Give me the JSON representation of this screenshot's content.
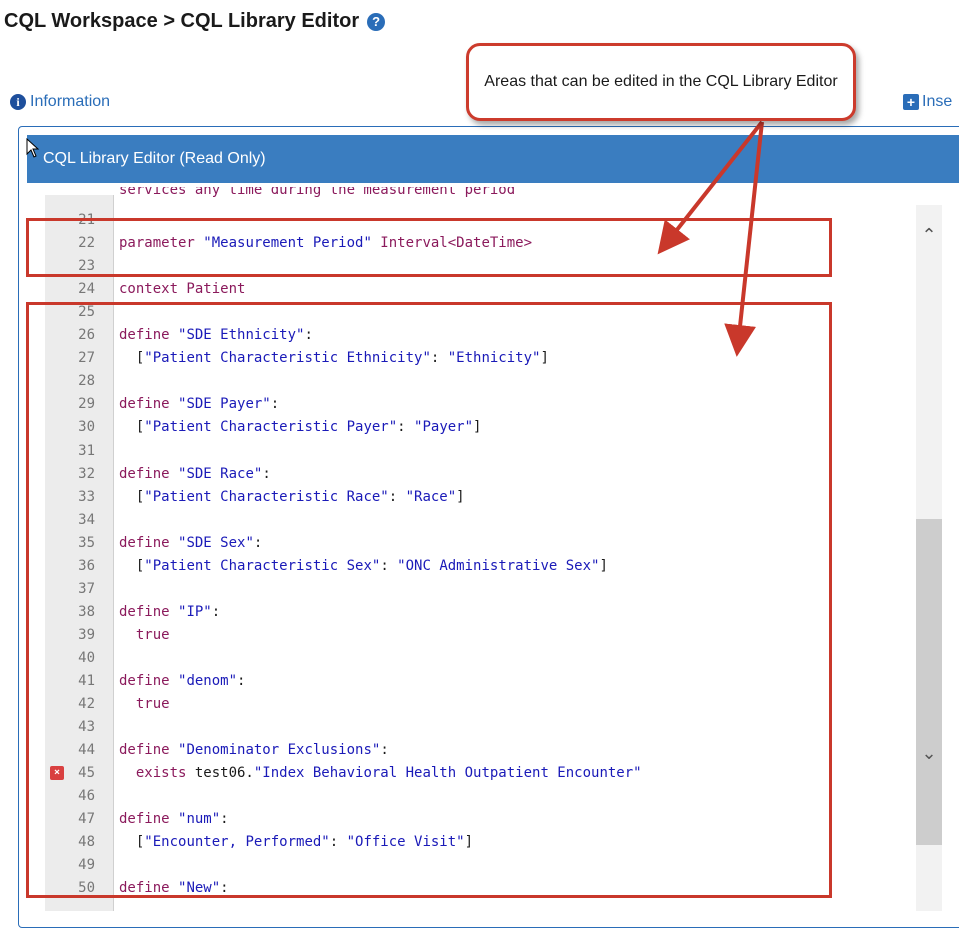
{
  "header": {
    "title": "CQL Workspace > CQL Library Editor",
    "help_icon": "question-circle-icon"
  },
  "toolbar": {
    "info_label": "Information",
    "insert_label": "Inse"
  },
  "panel": {
    "title": "CQL Library Editor (Read Only)"
  },
  "callout": {
    "text": "Areas that can be edited in the CQL Library Editor"
  },
  "colors": {
    "accent": "#3a7dc0",
    "highlight_red": "#c9382b",
    "keyword": "#8b1a5c",
    "string": "#1a1ab8"
  },
  "editor": {
    "partial_line_text": "services any time during the measurement period",
    "lines": [
      {
        "num": "21",
        "tokens": []
      },
      {
        "num": "22",
        "tokens": [
          {
            "t": "parameter ",
            "c": "kw"
          },
          {
            "t": "\"Measurement Period\"",
            "c": "str"
          },
          {
            "t": " Interval<DateTime>",
            "c": "kw"
          }
        ]
      },
      {
        "num": "23",
        "tokens": []
      },
      {
        "num": "24",
        "tokens": [
          {
            "t": "context Patient",
            "c": "kw"
          }
        ]
      },
      {
        "num": "25",
        "tokens": []
      },
      {
        "num": "26",
        "tokens": [
          {
            "t": "define ",
            "c": "kw"
          },
          {
            "t": "\"SDE Ethnicity\"",
            "c": "str"
          },
          {
            "t": ":",
            "c": "plain"
          }
        ]
      },
      {
        "num": "27",
        "tokens": [
          {
            "t": "  [",
            "c": "plain"
          },
          {
            "t": "\"Patient Characteristic Ethnicity\"",
            "c": "str"
          },
          {
            "t": ": ",
            "c": "plain"
          },
          {
            "t": "\"Ethnicity\"",
            "c": "str"
          },
          {
            "t": "]",
            "c": "plain"
          }
        ]
      },
      {
        "num": "28",
        "tokens": []
      },
      {
        "num": "29",
        "tokens": [
          {
            "t": "define ",
            "c": "kw"
          },
          {
            "t": "\"SDE Payer\"",
            "c": "str"
          },
          {
            "t": ":",
            "c": "plain"
          }
        ]
      },
      {
        "num": "30",
        "tokens": [
          {
            "t": "  [",
            "c": "plain"
          },
          {
            "t": "\"Patient Characteristic Payer\"",
            "c": "str"
          },
          {
            "t": ": ",
            "c": "plain"
          },
          {
            "t": "\"Payer\"",
            "c": "str"
          },
          {
            "t": "]",
            "c": "plain"
          }
        ]
      },
      {
        "num": "31",
        "tokens": []
      },
      {
        "num": "32",
        "tokens": [
          {
            "t": "define ",
            "c": "kw"
          },
          {
            "t": "\"SDE Race\"",
            "c": "str"
          },
          {
            "t": ":",
            "c": "plain"
          }
        ]
      },
      {
        "num": "33",
        "tokens": [
          {
            "t": "  [",
            "c": "plain"
          },
          {
            "t": "\"Patient Characteristic Race\"",
            "c": "str"
          },
          {
            "t": ": ",
            "c": "plain"
          },
          {
            "t": "\"Race\"",
            "c": "str"
          },
          {
            "t": "]",
            "c": "plain"
          }
        ]
      },
      {
        "num": "34",
        "tokens": []
      },
      {
        "num": "35",
        "tokens": [
          {
            "t": "define ",
            "c": "kw"
          },
          {
            "t": "\"SDE Sex\"",
            "c": "str"
          },
          {
            "t": ":",
            "c": "plain"
          }
        ]
      },
      {
        "num": "36",
        "tokens": [
          {
            "t": "  [",
            "c": "plain"
          },
          {
            "t": "\"Patient Characteristic Sex\"",
            "c": "str"
          },
          {
            "t": ": ",
            "c": "plain"
          },
          {
            "t": "\"ONC Administrative Sex\"",
            "c": "str"
          },
          {
            "t": "]",
            "c": "plain"
          }
        ]
      },
      {
        "num": "37",
        "tokens": []
      },
      {
        "num": "38",
        "tokens": [
          {
            "t": "define ",
            "c": "kw"
          },
          {
            "t": "\"IP\"",
            "c": "str"
          },
          {
            "t": ":",
            "c": "plain"
          }
        ]
      },
      {
        "num": "39",
        "tokens": [
          {
            "t": "  true",
            "c": "kw"
          }
        ]
      },
      {
        "num": "40",
        "tokens": []
      },
      {
        "num": "41",
        "tokens": [
          {
            "t": "define ",
            "c": "kw"
          },
          {
            "t": "\"denom\"",
            "c": "str"
          },
          {
            "t": ":",
            "c": "plain"
          }
        ]
      },
      {
        "num": "42",
        "tokens": [
          {
            "t": "  true",
            "c": "kw"
          }
        ]
      },
      {
        "num": "43",
        "tokens": []
      },
      {
        "num": "44",
        "tokens": [
          {
            "t": "define ",
            "c": "kw"
          },
          {
            "t": "\"Denominator Exclusions\"",
            "c": "str"
          },
          {
            "t": ":",
            "c": "plain"
          }
        ]
      },
      {
        "num": "45",
        "error": true,
        "tokens": [
          {
            "t": "  exists ",
            "c": "kw"
          },
          {
            "t": "test06.",
            "c": "plain"
          },
          {
            "t": "\"Index Behavioral Health Outpatient Encounter\"",
            "c": "str"
          }
        ]
      },
      {
        "num": "46",
        "tokens": []
      },
      {
        "num": "47",
        "tokens": [
          {
            "t": "define ",
            "c": "kw"
          },
          {
            "t": "\"num\"",
            "c": "str"
          },
          {
            "t": ":",
            "c": "plain"
          }
        ]
      },
      {
        "num": "48",
        "tokens": [
          {
            "t": "  [",
            "c": "plain"
          },
          {
            "t": "\"Encounter, Performed\"",
            "c": "str"
          },
          {
            "t": ": ",
            "c": "plain"
          },
          {
            "t": "\"Office Visit\"",
            "c": "str"
          },
          {
            "t": "]",
            "c": "plain"
          }
        ]
      },
      {
        "num": "49",
        "tokens": []
      },
      {
        "num": "50",
        "tokens": [
          {
            "t": "define ",
            "c": "kw"
          },
          {
            "t": "\"New\"",
            "c": "str"
          },
          {
            "t": ":",
            "c": "plain"
          }
        ]
      }
    ]
  }
}
